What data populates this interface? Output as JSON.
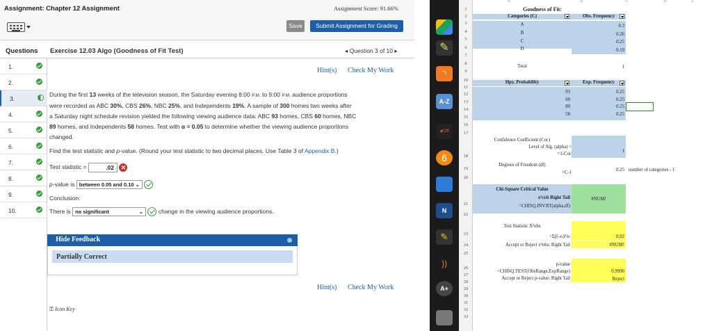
{
  "header": {
    "title": "Assignment: Chapter 12 Assignment",
    "score": "Assignment Score: 91.66%",
    "save_label": "Save",
    "submit_label": "Submit Assignment for Grading"
  },
  "questions": {
    "label": "Questions",
    "exercise": "Exercise 12.03 Algo (Goodness of Fit Test)",
    "nav": "◂ Question 3 of 10 ▸",
    "items": [
      "1.",
      "2.",
      "3.",
      "4.",
      "5.",
      "6.",
      "7.",
      "8.",
      "9.",
      "10."
    ]
  },
  "links": {
    "hint": "Hint(s)",
    "check": "Check My Work"
  },
  "problem": {
    "l1a": "During the first ",
    "l1b": "13",
    "l1c": " weeks of the television season, the Saturday evening 8:00 ",
    "l1d": "P.M.",
    "l1e": " to 9:00 ",
    "l1f": "P.M.",
    "l1g": " audience proportions",
    "l2a": "were recorded as ABC ",
    "l2b": "30%",
    "l2c": ", CBS ",
    "l2d": "26%",
    "l2e": ", NBC ",
    "l2f": "25%",
    "l2g": ", and Independents ",
    "l2h": "19%",
    "l2i": ". A sample of ",
    "l2j": "300",
    "l2k": " homes two weeks after",
    "l3a": "a Saturday night schedule revision yielded the following viewing audience data: ABC ",
    "l3b": "93",
    "l3c": " homes, CBS ",
    "l3d": "60",
    "l3e": " homes, NBC",
    "l4a": "89",
    "l4b": " homes, and Independents ",
    "l4c": "58",
    "l4d": " homes. Test with ",
    "l4e": "α = 0.05",
    "l4f": " to determine whether the viewing audience proportions",
    "l5": "changed.",
    "find1": "Find the test statistic and ",
    "find2": "p",
    "find3": "-value. (Round your test statistic to two decimal places. Use Table 3 of ",
    "find4": "Appendix B",
    "find5": ".)",
    "ts_label": "Test statistic =",
    "ts_value": ".02",
    "pv_label1": "p",
    "pv_label2": "-value is",
    "pv_value": "between 0.05 and 0.10",
    "concl_label": "Conclusion:",
    "there": "There is",
    "there_value": "no significant",
    "there_tail": "change in the viewing audience proportions."
  },
  "feedback": {
    "title": "Hide Feedback",
    "status": "Partially Correct"
  },
  "icon_key": "Icon Key",
  "sheet": {
    "col_headers": [
      "A",
      "B",
      "C",
      "D",
      "E"
    ],
    "rows": [
      "1",
      "2",
      "3",
      "4",
      "5",
      "6",
      "7",
      "8",
      "9",
      "10",
      "11",
      "12",
      "13",
      "14",
      "15",
      "16",
      "17",
      "18",
      "19",
      "20",
      "21",
      "22",
      "23",
      "24",
      "25",
      "26",
      "27",
      "28",
      "29",
      "30",
      "31",
      "32",
      "33"
    ],
    "gof_title": "Goodness of Fit:",
    "cat_header": "Categories (C)",
    "obs_header": "Obs. Frequency",
    "cats": [
      "A",
      "B",
      "C",
      "D"
    ],
    "obs": [
      "0.3",
      "0.26",
      "0.25",
      "0.19"
    ],
    "total_label": "Total",
    "total_value": "1",
    "hyp_header": "Hpy. Probability",
    "exp_header": "Exp. Frequency",
    "hyp": [
      "93",
      "60",
      "89",
      "58"
    ],
    "exp": [
      "0.25",
      "0.25",
      "0.25",
      "0.25"
    ],
    "conf1": "Confidence Coefficient (Coc)",
    "conf2": "Level of Sig. (alpha) =",
    "conf3": "=1-Coc",
    "conf_value": "1",
    "dof1": "Degrees of Freedom (df)",
    "dof2": "=C-1",
    "dof_value": "0.25",
    "dof_note": "number of categories - 1",
    "chi1": "Chi-Square Critical Value",
    "chi2": "x²crit Right Tail",
    "chi3": "=CHISQ.INV.RT(alpha,df)",
    "chi_value": "#NUM!",
    "ts1": "Test Statistic X²obs",
    "ts2": "=Σ(fᵢ-eᵢ)²/eᵢ",
    "ts_value": "0.02",
    "acc1": "Accept or Reject x²obs: Right Tail",
    "acc_value": "#NUM!",
    "pv1": "p-value",
    "pv2": "=CHISQ.TEST(ObsRange,ExpRange)",
    "pv_value": "0.9990",
    "acc2": "Accept or Reject p-value: Right Tail",
    "acc2_value": "Reject"
  }
}
